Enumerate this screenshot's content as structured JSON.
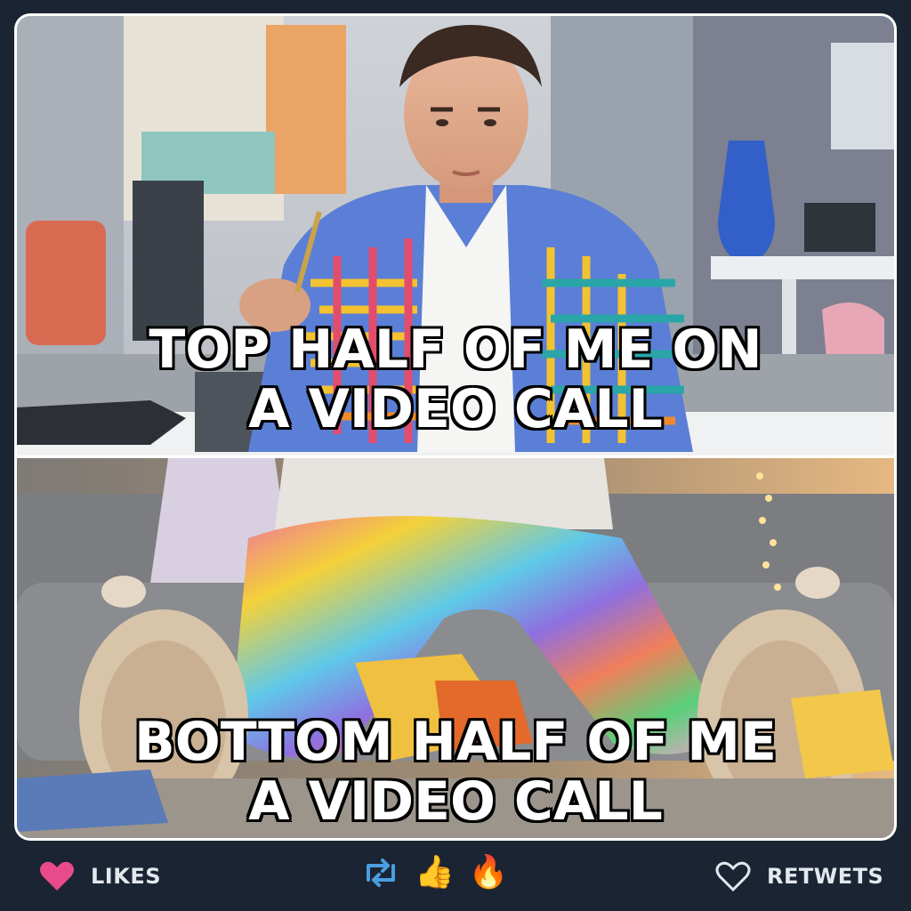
{
  "meme": {
    "caption_top_lines": [
      "TOP HALF OF ME ON",
      "A VIDEO CALL"
    ],
    "caption_bottom_lines": [
      "BOTTOM HALF OF ME",
      "A VIDEO CALL"
    ],
    "image_top_alt": "man in patterned blazer at desk",
    "image_bottom_alt": "tie-dye sweatpants and slippers on couch"
  },
  "action_bar": {
    "likes_label": "LIKES",
    "retweets_label": "RETWETS",
    "center_icons": [
      {
        "name": "retweet-icon",
        "glyph": "⇄"
      },
      {
        "name": "thumbs-up-icon",
        "glyph": "👍"
      },
      {
        "name": "fire-icon",
        "glyph": "🔥"
      }
    ]
  },
  "colors": {
    "background": "#1b2433",
    "like_heart": "#e94b8a",
    "retweet": "#4a9fe0",
    "label_text": "#e3e7ee"
  }
}
